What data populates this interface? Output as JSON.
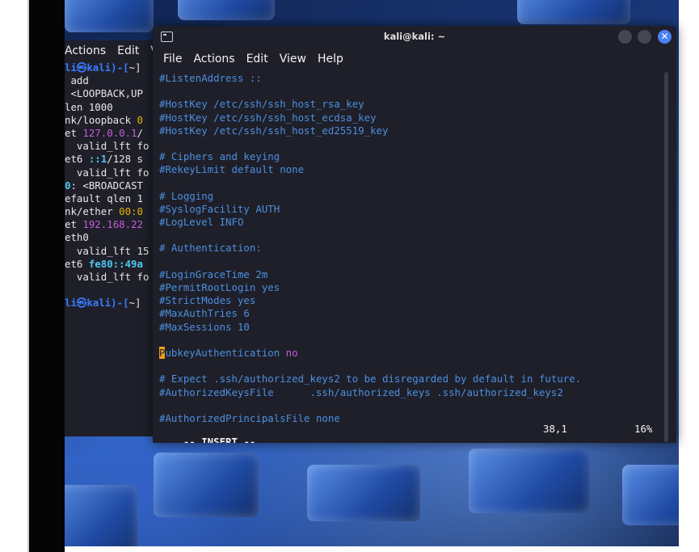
{
  "background_terminal": {
    "menu": [
      "Actions",
      "Edit",
      "V"
    ],
    "lines": [
      [
        {
          "t": "li",
          "c": "c-blue"
        },
        {
          "t": "㉿",
          "c": "c-blue"
        },
        {
          "t": "kali",
          "c": "c-blue"
        },
        {
          "t": ")-[",
          "c": "c-blue"
        },
        {
          "t": "~]",
          "c": "c-white"
        }
      ],
      [
        {
          "t": " add",
          "c": "c-white"
        }
      ],
      [
        {
          "t": " <LOOPBACK,UP",
          "c": "c-white"
        }
      ],
      [
        {
          "t": "len 1000",
          "c": "c-white"
        }
      ],
      [
        {
          "t": "nk/loopback ",
          "c": "c-white"
        },
        {
          "t": "0",
          "c": "c-yel"
        }
      ],
      [
        {
          "t": "et ",
          "c": "c-white"
        },
        {
          "t": "127.0.0.1",
          "c": "c-mag"
        },
        {
          "t": "/",
          "c": "c-white"
        }
      ],
      [
        {
          "t": "  valid_lft fo",
          "c": "c-white"
        }
      ],
      [
        {
          "t": "et6 ",
          "c": "c-white"
        },
        {
          "t": "::1",
          "c": "c-cyan"
        },
        {
          "t": "/128 s",
          "c": "c-white"
        }
      ],
      [
        {
          "t": "  valid_lft fo",
          "c": "c-white"
        }
      ],
      [
        {
          "t": "0",
          "c": "c-cyan"
        },
        {
          "t": ": <BROADCAST",
          "c": "c-white"
        }
      ],
      [
        {
          "t": "efault qlen 1",
          "c": "c-white"
        }
      ],
      [
        {
          "t": "nk/ether ",
          "c": "c-white"
        },
        {
          "t": "00:0",
          "c": "c-yel"
        }
      ],
      [
        {
          "t": "et ",
          "c": "c-white"
        },
        {
          "t": "192.168.22",
          "c": "c-mag"
        }
      ],
      [
        {
          "t": "eth0",
          "c": "c-white"
        }
      ],
      [
        {
          "t": "  valid_lft 15",
          "c": "c-white"
        }
      ],
      [
        {
          "t": "et6 ",
          "c": "c-white"
        },
        {
          "t": "fe80::49a",
          "c": "c-cyan"
        }
      ],
      [
        {
          "t": "  valid_lft fo",
          "c": "c-white"
        }
      ],
      [
        {
          "t": "",
          "c": "c-white"
        }
      ],
      [
        {
          "t": "li",
          "c": "c-blue"
        },
        {
          "t": "㉿",
          "c": "c-blue"
        },
        {
          "t": "kali",
          "c": "c-blue"
        },
        {
          "t": ")-[",
          "c": "c-blue"
        },
        {
          "t": "~]",
          "c": "c-white"
        }
      ]
    ]
  },
  "terminal": {
    "title": "kali@kali: ~",
    "close_glyph": "✕",
    "menu": [
      "File",
      "Actions",
      "Edit",
      "View",
      "Help"
    ],
    "lines": [
      "#ListenAddress ::",
      "",
      "#HostKey /etc/ssh/ssh_host_rsa_key",
      "#HostKey /etc/ssh/ssh_host_ecdsa_key",
      "#HostKey /etc/ssh/ssh_host_ed25519_key",
      "",
      "# Ciphers and keying",
      "#RekeyLimit default none",
      "",
      "# Logging",
      "#SyslogFacility AUTH",
      "#LogLevel INFO",
      "",
      "# Authentication:",
      "",
      "#LoginGraceTime 2m",
      "#PermitRootLogin yes",
      "#StrictModes yes",
      "#MaxAuthTries 6",
      "#MaxSessions 10",
      "",
      "__PUBKEY__",
      "",
      "# Expect .ssh/authorized_keys2 to be disregarded by default in future.",
      "#AuthorizedKeysFile      .ssh/authorized_keys .ssh/authorized_keys2",
      "",
      "#AuthorizedPrincipalsFile none"
    ],
    "cursor_line": {
      "cursor_char": "P",
      "rest": "ubkeyAuthentication ",
      "value": "no"
    },
    "status": {
      "mode": "-- INSERT --",
      "position": "38,1",
      "percent": "16%"
    },
    "colors": {
      "text": "#4d8fe0",
      "cursor": "#f0a020",
      "value": "#c35dd8",
      "background": "#1e1f29"
    }
  }
}
